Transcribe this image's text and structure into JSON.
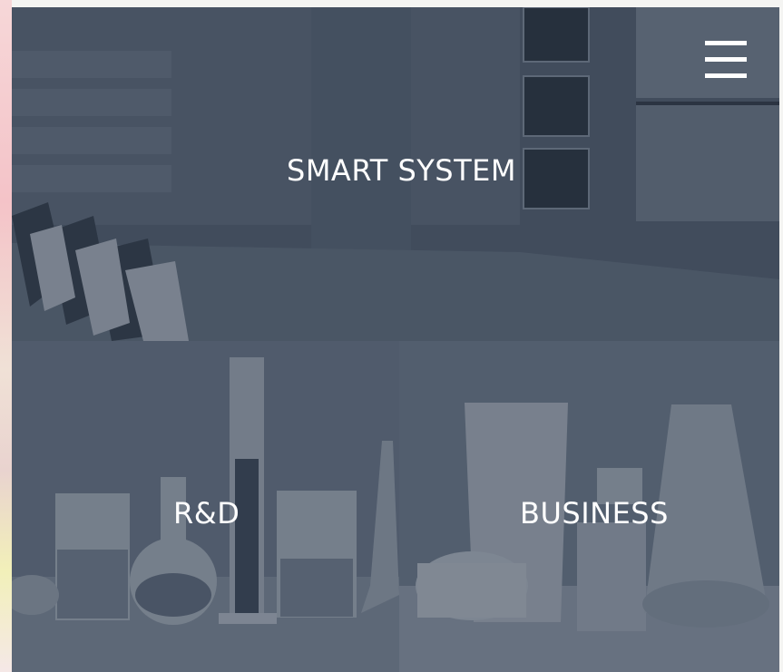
{
  "panels": {
    "smart_system": {
      "title": "SMART SYSTEM"
    },
    "rnd": {
      "title": "R&D"
    },
    "business": {
      "title": "BUSINESS"
    }
  },
  "header": {
    "menu_icon": "hamburger-menu-icon"
  },
  "colors": {
    "overlay": "#2c384a",
    "text": "#ffffff"
  }
}
